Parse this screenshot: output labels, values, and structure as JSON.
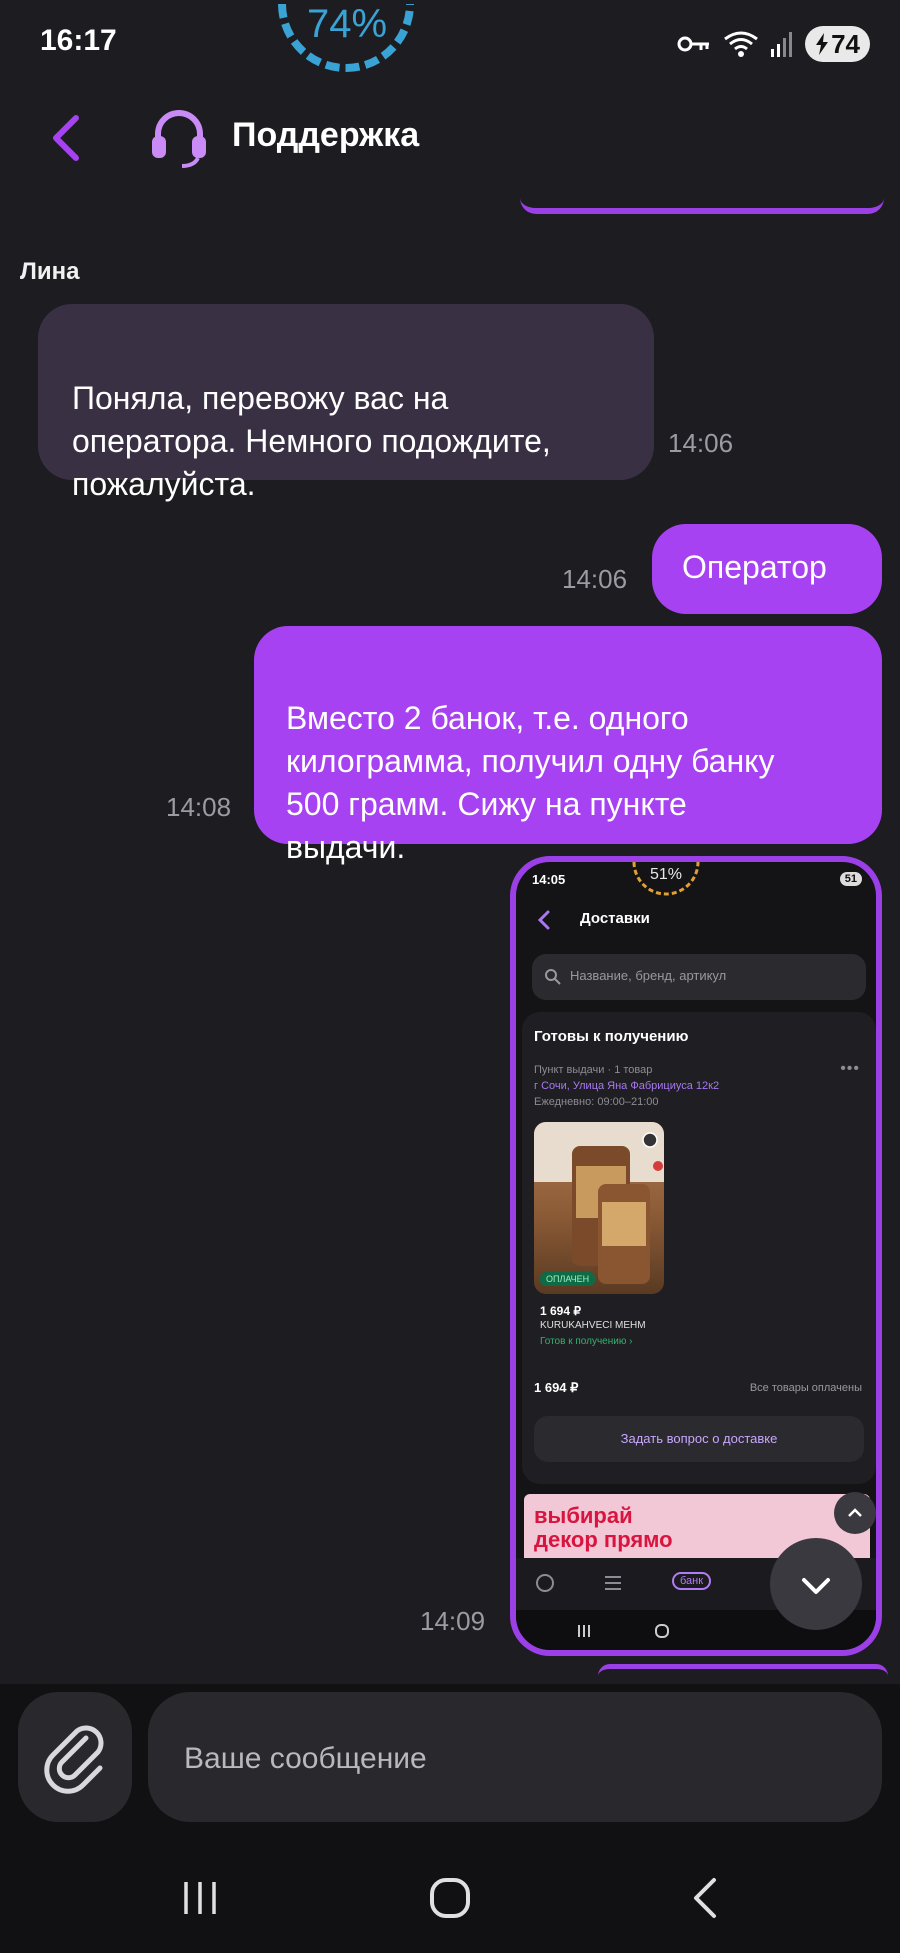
{
  "status_bar": {
    "time": "16:17",
    "gauge_percent": "74%",
    "battery": "74"
  },
  "header": {
    "title": "Поддержка",
    "back_icon": "chevron-left-icon",
    "support_icon": "headset-icon"
  },
  "chat": {
    "sender_name": "Лина",
    "messages": [
      {
        "direction": "in",
        "text": "Поняла, перевожу вас на\nоператора. Немного подождите,\nпожалуйста.",
        "time": "14:06"
      },
      {
        "direction": "out",
        "text": "Оператор",
        "time": "14:06"
      },
      {
        "direction": "out",
        "text": "Вместо 2 банок, т.е. одного\nкилограмма, получил одну банку\n500 грамм. Сижу на пункте\nвыдачи.",
        "time": "14:08"
      },
      {
        "direction": "out",
        "type": "image",
        "time": "14:09"
      }
    ]
  },
  "screenshot": {
    "time": "14:05",
    "gauge_percent": "51%",
    "battery": "51",
    "title": "Доставки",
    "search_placeholder": "Название, бренд, артикул",
    "section_title": "Готовы к получению",
    "pickup_type": "Пункт выдачи · 1 товар",
    "address": "г Сочи, Улица Яна Фабрициуса 12к2",
    "hours": "Ежедневно: 09:00–21:00",
    "paid_badge": "ОПЛАЧЕН",
    "item_price": "1 694 ₽",
    "item_name": "KURUKAHVECI MEHM",
    "item_status": "Готов к получению ›",
    "total": "1 694 ₽",
    "all_paid": "Все товары оплачены",
    "ask_button": "Задать вопрос о доставке",
    "banner_text": "выбирай\nдекор прямо",
    "nav_bank": "банк"
  },
  "composer": {
    "placeholder": "Ваше сообщение",
    "attach_icon": "paperclip-icon"
  },
  "system_nav": {
    "recents_icon": "recents-icon",
    "home_icon": "home-icon",
    "back_icon": "back-icon"
  },
  "colors": {
    "accent": "#a742f2",
    "bubble_in": "#393043",
    "background": "#1d1c20"
  }
}
